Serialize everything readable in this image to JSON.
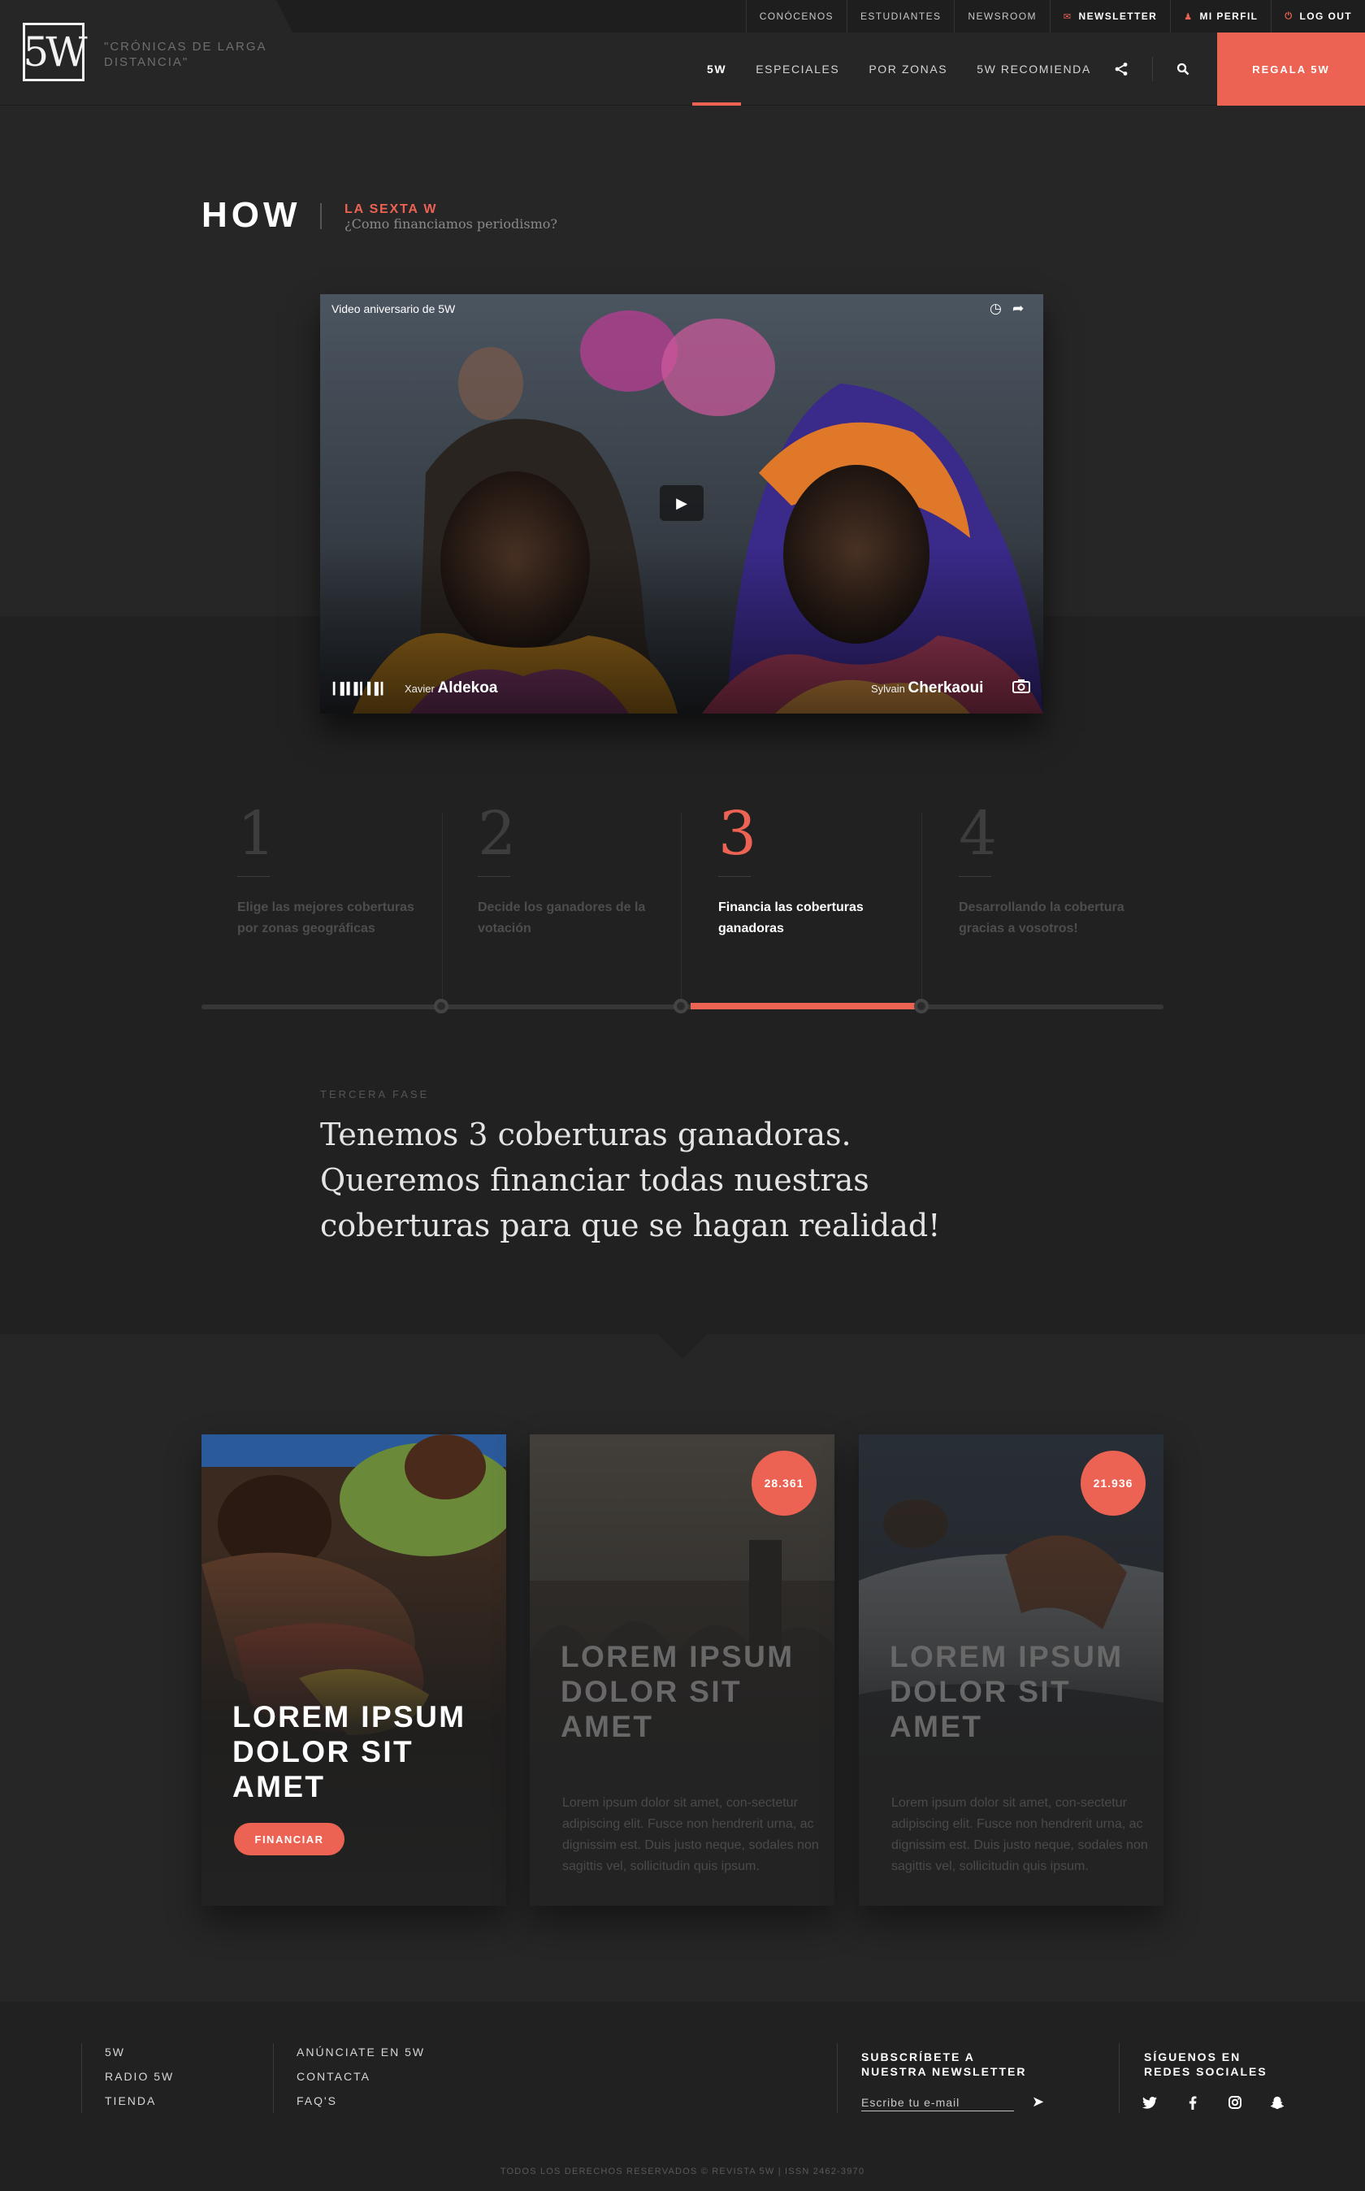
{
  "header": {
    "logo_text": "5W",
    "tagline": "\"CRÓNICAS DE LARGA DISTANCIA\"",
    "top_links": [
      {
        "label": "CONÓCENOS",
        "icon": ""
      },
      {
        "label": "ESTUDIANTES",
        "icon": ""
      },
      {
        "label": "NEWSROOM",
        "icon": ""
      },
      {
        "label": "NEWSLETTER",
        "icon": "mail-icon"
      },
      {
        "label": "MI PERFIL",
        "icon": "user-icon"
      },
      {
        "label": "LOG OUT",
        "icon": "power-icon"
      }
    ],
    "nav": [
      {
        "label": "5W",
        "active": true
      },
      {
        "label": "ESPECIALES",
        "active": false
      },
      {
        "label": "POR ZONAS",
        "active": false
      },
      {
        "label": "5W  RECOMIENDA",
        "active": false
      }
    ],
    "share_icon": "share-icon",
    "search_icon": "search-icon",
    "cta_label": "REGALA 5W",
    "accent_color": "#ec6354"
  },
  "hero": {
    "title": "HOW",
    "kicker": "LA SEXTA W",
    "subtitle": "¿Como financiamos periodismo?"
  },
  "video": {
    "title": "Video aniversario de 5W",
    "icons": [
      "clock-icon",
      "share-arrow-icon",
      "play-icon",
      "camera-icon"
    ],
    "credit_left_first": "Xavier",
    "credit_left_last": "Aldekoa",
    "credit_right_first": "Sylvain",
    "credit_right_last": "Cherkaoui"
  },
  "steps": [
    {
      "number": "1",
      "text": "Elige las mejores coberturas por zonas geográficas",
      "active": false
    },
    {
      "number": "2",
      "text": "Decide los ganadores de la votación",
      "active": false
    },
    {
      "number": "3",
      "text": "Financia las coberturas ganadoras",
      "active": true
    },
    {
      "number": "4",
      "text": "Desarrollando la cobertura gracias a vosotros!",
      "active": false
    }
  ],
  "phase": {
    "label": "TERCERA FASE",
    "text": "Tenemos 3 coberturas ganadoras. Queremos financiar todas nuestras coberturas para que se hagan realidad!"
  },
  "cards": [
    {
      "title": "LOREM IPSUM DOLOR SIT AMET",
      "button": "FINANCIAR",
      "badge": "",
      "body": ""
    },
    {
      "title": "LOREM IPSUM DOLOR SIT AMET",
      "button": "",
      "badge": "28.361",
      "body": "Lorem ipsum dolor sit amet, con-sectetur adipiscing elit. Fusce non hendrerit urna, ac dignissim est. Duis justo neque, sodales non sagittis vel, sollicitudin quis ipsum."
    },
    {
      "title": "LOREM IPSUM DOLOR SIT AMET",
      "button": "",
      "badge": "21.936",
      "body": "Lorem ipsum dolor sit amet, con-sectetur adipiscing elit. Fusce non hendrerit urna, ac dignissim est. Duis justo neque, sodales non sagittis vel, sollicitudin quis ipsum."
    }
  ],
  "footer": {
    "col1": [
      "5W",
      "RADIO 5W",
      "TIENDA"
    ],
    "col2": [
      "ANÚNCIATE EN 5W",
      "CONTACTA",
      "FAQ'S"
    ],
    "newsletter_heading": "SUBSCRÍBETE A NUESTRA NEWSLETTER",
    "email_placeholder": "Escribe tu e-mail",
    "social_heading": "SÍGUENOS EN REDES SOCIALES",
    "social_icons": [
      "twitter-icon",
      "facebook-icon",
      "instagram-icon",
      "snapchat-icon"
    ],
    "copyright": "TODOS LOS DERECHOS RESERVADOS © REVISTA 5W | ISSN 2462-3970"
  }
}
